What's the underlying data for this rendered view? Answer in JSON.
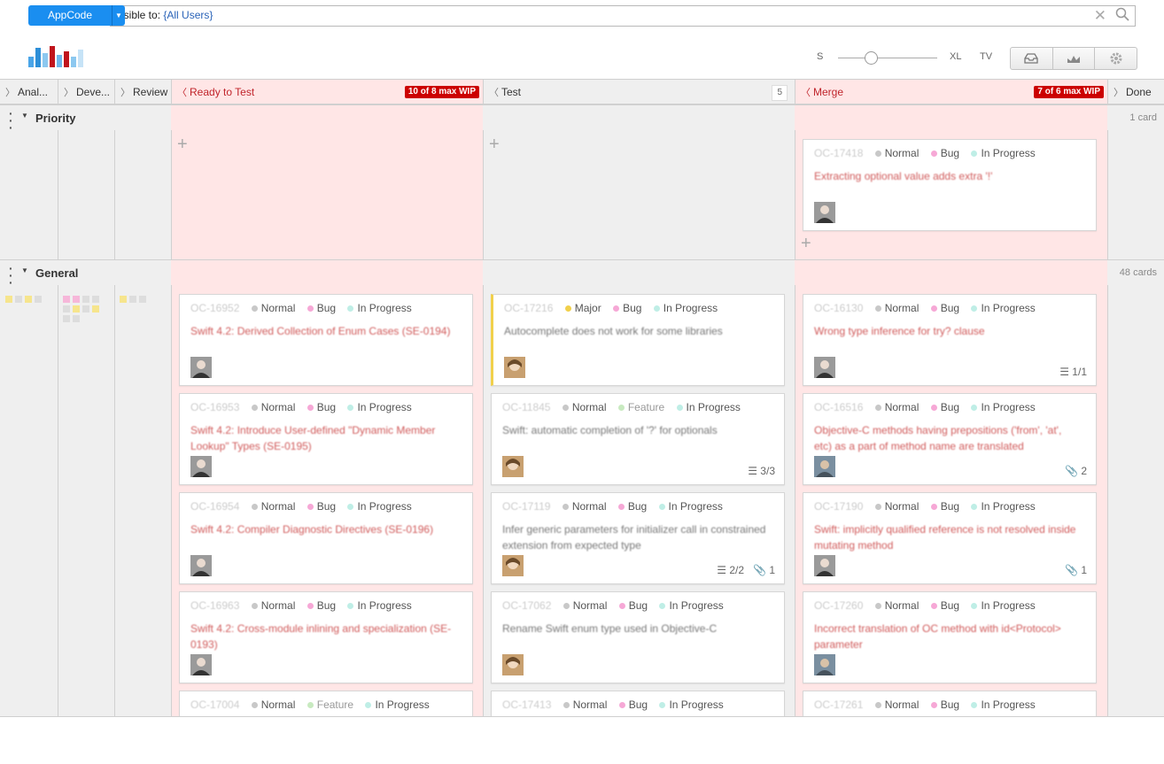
{
  "topbar": {
    "project": "AppCode",
    "query_prefix": "visible to: ",
    "query_value": "{All Users}"
  },
  "size_control": {
    "s": "S",
    "xl": "XL",
    "tv": "TV"
  },
  "columns": [
    {
      "name": "Anal...",
      "color": "grey"
    },
    {
      "name": "Deve...",
      "color": "grey"
    },
    {
      "name": "Review",
      "color": "grey"
    },
    {
      "name": "Ready to Test",
      "wip": "10 of 8 max WIP",
      "color": "red"
    },
    {
      "name": "Test",
      "count": "5",
      "color": "grey"
    },
    {
      "name": "Merge",
      "wip": "7 of 6 max WIP",
      "color": "red"
    },
    {
      "name": "Done",
      "color": "grey"
    }
  ],
  "swimlanes": [
    {
      "title": "Priority",
      "count": "1 card"
    },
    {
      "title": "General",
      "count": "48 cards"
    }
  ],
  "cards": {
    "priority_merge": {
      "id": "OC-17418",
      "priority": "Normal",
      "type": "Bug",
      "state": "In Progress",
      "summary": "Extracting optional value adds extra '!'"
    },
    "ready": [
      {
        "id": "OC-16952",
        "priority": "Normal",
        "type": "Bug",
        "state": "In Progress",
        "summary": "Swift 4.2: Derived Collection of Enum Cases (SE-0194)"
      },
      {
        "id": "OC-16953",
        "priority": "Normal",
        "type": "Bug",
        "state": "In Progress",
        "summary": "Swift 4.2: Introduce User-defined \"Dynamic Member Lookup\" Types (SE-0195)"
      },
      {
        "id": "OC-16954",
        "priority": "Normal",
        "type": "Bug",
        "state": "In Progress",
        "summary": "Swift 4.2: Compiler Diagnostic Directives (SE-0196)"
      },
      {
        "id": "OC-16963",
        "priority": "Normal",
        "type": "Bug",
        "state": "In Progress",
        "summary": "Swift 4.2: Cross-module inlining and specialization (SE-0193)"
      },
      {
        "id": "OC-17004",
        "priority": "Normal",
        "type": "Feature",
        "state": "In Progress",
        "summary": ""
      }
    ],
    "test": [
      {
        "id": "OC-17216",
        "priority": "Major",
        "type": "Bug",
        "state": "In Progress",
        "summary": "Autocomplete does not work for some libraries",
        "f1": "",
        "f2": ""
      },
      {
        "id": "OC-11845",
        "priority": "Normal",
        "type": "Feature",
        "state": "In Progress",
        "summary": "Swift: automatic completion of '?' for optionals",
        "f1": "3/3",
        "f2": ""
      },
      {
        "id": "OC-17119",
        "priority": "Normal",
        "type": "Bug",
        "state": "In Progress",
        "summary": "Infer generic parameters for initializer call in constrained extension from expected type",
        "f1": "2/2",
        "f2": "1"
      },
      {
        "id": "OC-17062",
        "priority": "Normal",
        "type": "Bug",
        "state": "In Progress",
        "summary": "Rename Swift enum type used in Objective-C",
        "f1": "",
        "f2": ""
      },
      {
        "id": "OC-17413",
        "priority": "Normal",
        "type": "Bug",
        "state": "In Progress",
        "summary": "",
        "f1": "",
        "f2": ""
      }
    ],
    "merge": [
      {
        "id": "OC-16130",
        "priority": "Normal",
        "type": "Bug",
        "state": "In Progress",
        "summary": "Wrong type inference for try? clause",
        "f1": "1/1",
        "f2": ""
      },
      {
        "id": "OC-16516",
        "priority": "Normal",
        "type": "Bug",
        "state": "In Progress",
        "summary": "Objective-C methods having prepositions ('from', 'at', etc) as a part of method name are translated",
        "f1": "",
        "f2": "2"
      },
      {
        "id": "OC-17190",
        "priority": "Normal",
        "type": "Bug",
        "state": "In Progress",
        "summary": "Swift: implicitly qualified reference is not resolved inside mutating method",
        "f1": "",
        "f2": "1"
      },
      {
        "id": "OC-17260",
        "priority": "Normal",
        "type": "Bug",
        "state": "In Progress",
        "summary": "Incorrect translation of OC method with id<Protocol> parameter",
        "f1": "",
        "f2": ""
      },
      {
        "id": "OC-17261",
        "priority": "Normal",
        "type": "Bug",
        "state": "In Progress",
        "summary": "",
        "f1": "",
        "f2": ""
      }
    ]
  },
  "colors": {
    "accent": "#1a8ef0",
    "wip_red": "#cc0000",
    "lane_red": "#ffe6e6",
    "lane_grey": "#efefef",
    "normal_dot": "#c8c8c8",
    "major_dot": "#f1d04b",
    "bug_dot": "#f6a8d6",
    "feature_dot": "#c8eac0",
    "state_dot": "#bfeee6"
  }
}
